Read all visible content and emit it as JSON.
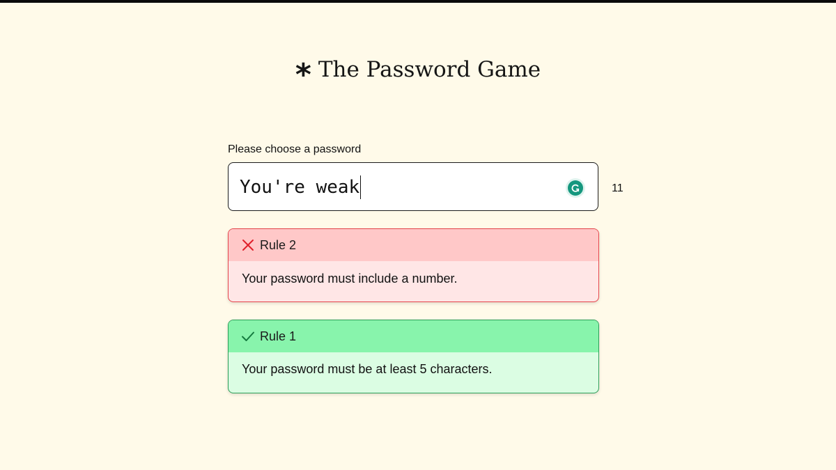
{
  "header": {
    "title": "The Password Game",
    "title_icon": "asterisk-icon"
  },
  "password": {
    "label": "Please choose a password",
    "value": "You're weak",
    "char_count": "11",
    "assistant_icon": "grammarly-icon"
  },
  "rules": [
    {
      "title": "Rule 2",
      "text": "Your password must include a number.",
      "status": "failed",
      "status_icon": "cross-icon",
      "accent": "#e5444a"
    },
    {
      "title": "Rule 1",
      "text": "Your password must be at least 5 characters.",
      "status": "passed",
      "status_icon": "check-icon",
      "accent": "#2c9e57"
    }
  ]
}
